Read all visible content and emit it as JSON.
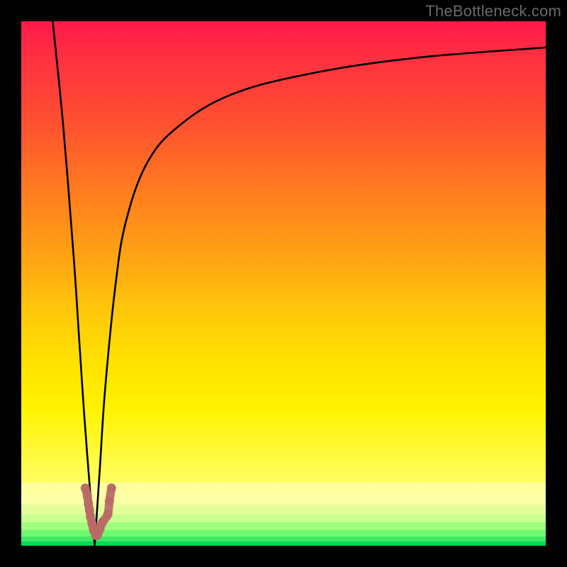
{
  "watermark": "TheBottleneck.com",
  "colors": {
    "frame": "#000000",
    "curve": "#000000",
    "fitPoints": "#b86a66",
    "gradientTop": "#ff1a4a",
    "gradientBottom": "#00d858"
  },
  "chart_data": {
    "type": "line",
    "title": "",
    "xlabel": "",
    "ylabel": "",
    "xlim": [
      0,
      100
    ],
    "ylim": [
      0,
      100
    ],
    "grid": false,
    "legend": false,
    "series": [
      {
        "name": "left-branch",
        "x": [
          6,
          8,
          10,
          11,
          12,
          13,
          14
        ],
        "y": [
          100,
          80,
          55,
          40,
          25,
          12,
          0
        ]
      },
      {
        "name": "right-branch",
        "x": [
          14,
          15,
          16,
          18,
          20,
          24,
          30,
          40,
          55,
          75,
          100
        ],
        "y": [
          0,
          15,
          30,
          50,
          62,
          73,
          80,
          86,
          90,
          93,
          95
        ]
      }
    ],
    "fit_points": {
      "name": "fit-dots",
      "x": [
        12.2,
        12.6,
        12.8,
        13.0,
        13.2,
        13.5,
        13.8,
        14.2,
        14.5,
        15.0,
        15.5,
        16.5,
        16.8,
        17.2
      ],
      "y": [
        11,
        9.5,
        8,
        6.8,
        5.5,
        4.2,
        3.0,
        2.0,
        2.0,
        3.2,
        4.5,
        6.0,
        8.5,
        11.0
      ]
    },
    "gradient_meaning": "background encodes bottleneck severity: red=high, green=low"
  }
}
